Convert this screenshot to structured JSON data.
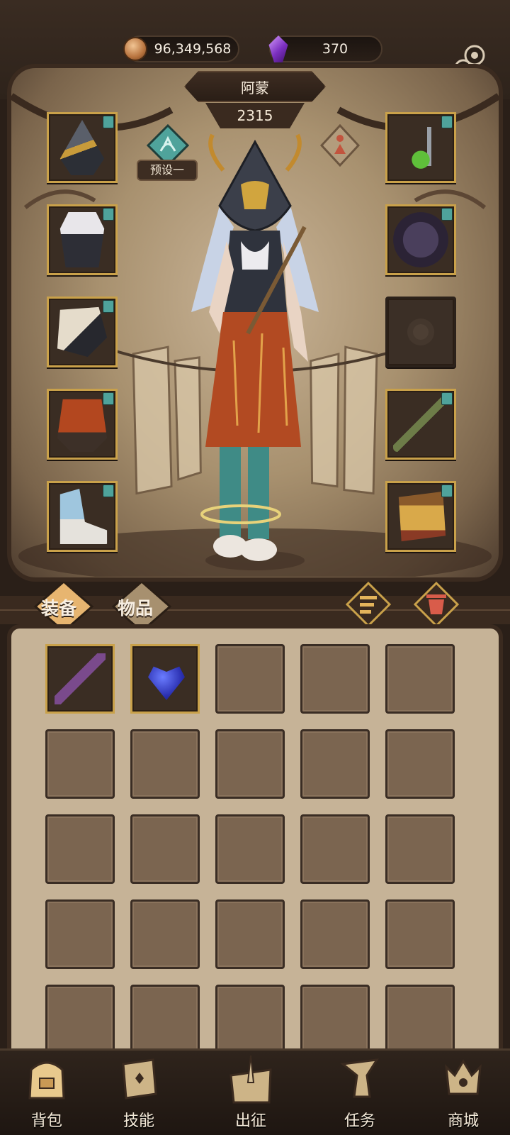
{
  "currency": {
    "gold": "96,349,568",
    "gems": "370"
  },
  "hero": {
    "name": "阿蒙",
    "power": "2315",
    "preset_label": "预设一"
  },
  "left_slots": [
    {
      "name": "helmet-slot",
      "item": "hooded-helmet-icon"
    },
    {
      "name": "armor-slot",
      "item": "corset-armor-icon"
    },
    {
      "name": "gloves-slot",
      "item": "gauntlet-icon"
    },
    {
      "name": "pants-slot",
      "item": "skirt-pants-icon"
    },
    {
      "name": "boots-slot",
      "item": "ice-boots-icon"
    }
  ],
  "right_slots": [
    {
      "name": "necklace-slot",
      "item": "green-pendant-icon"
    },
    {
      "name": "belt-slot",
      "item": "bracer-icon"
    },
    {
      "name": "relic-slot",
      "item": "empty-rose-slot-icon"
    },
    {
      "name": "weapon-slot",
      "item": "staff-icon"
    },
    {
      "name": "offhand-slot",
      "item": "scroll-case-icon"
    }
  ],
  "tabs": {
    "equip": "装备",
    "items": "物品"
  },
  "inventory": [
    {
      "name": "twisted-staff-icon"
    },
    {
      "name": "blue-heart-amulet-icon"
    }
  ],
  "nav": [
    {
      "label": "背包",
      "icon": "backpack-icon"
    },
    {
      "label": "技能",
      "icon": "skill-book-icon"
    },
    {
      "label": "出征",
      "icon": "expedition-map-icon"
    },
    {
      "label": "任务",
      "icon": "quest-horn-icon"
    },
    {
      "label": "商城",
      "icon": "shop-crown-icon"
    }
  ],
  "colors": {
    "gold_frame": "#c9a14a",
    "panel": "#c6b397",
    "dark": "#2a1f18",
    "teal_tag": "#4fa39b"
  }
}
